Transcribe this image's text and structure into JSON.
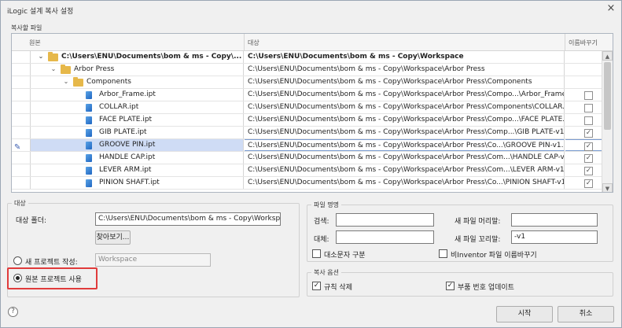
{
  "window": {
    "title": "iLogic 설계 복사 설정",
    "close_glyph": "×"
  },
  "files_section": {
    "label": "복사할 파일",
    "columns": {
      "source": "원본",
      "destination": "대상",
      "rename": "이름바꾸기"
    },
    "rows": [
      {
        "type": "folder",
        "expand": "⌄",
        "level": 0,
        "source": "C:\\Users\\ENU\\Documents\\bom & ms - Copy\\...",
        "destination": "C:\\Users\\ENU\\Documents\\bom & ms - Copy\\Workspace",
        "bold": true,
        "checkbox": null
      },
      {
        "type": "folder",
        "expand": "⌄",
        "level": 1,
        "source": "Arbor Press",
        "destination": "C:\\Users\\ENU\\Documents\\bom & ms - Copy\\Workspace\\Arbor Press",
        "bold": false,
        "checkbox": null
      },
      {
        "type": "folder",
        "expand": "⌄",
        "level": 2,
        "source": "Components",
        "destination": "C:\\Users\\ENU\\Documents\\bom & ms - Copy\\Workspace\\Arbor Press\\Components",
        "bold": false,
        "checkbox": null
      },
      {
        "type": "part",
        "level": 3,
        "source": "Arbor_Frame.ipt",
        "destination": "C:\\Users\\ENU\\Documents\\bom & ms - Copy\\Workspace\\Arbor Press\\Compo...\\Arbor_Frame.ipt",
        "bold": false,
        "checkbox": ""
      },
      {
        "type": "part",
        "level": 3,
        "source": "COLLAR.ipt",
        "destination": "C:\\Users\\ENU\\Documents\\bom & ms - Copy\\Workspace\\Arbor Press\\Components\\COLLAR.ipt",
        "bold": false,
        "checkbox": ""
      },
      {
        "type": "part",
        "level": 3,
        "source": "FACE PLATE.ipt",
        "destination": "C:\\Users\\ENU\\Documents\\bom & ms - Copy\\Workspace\\Arbor Press\\Compo...\\FACE PLATE.ipt",
        "bold": false,
        "checkbox": ""
      },
      {
        "type": "part",
        "level": 3,
        "source": "GIB PLATE.ipt",
        "destination": "C:\\Users\\ENU\\Documents\\bom & ms - Copy\\Workspace\\Arbor Press\\Comp...\\GIB PLATE-v1.ipt",
        "bold": false,
        "checkbox": "✓"
      },
      {
        "type": "part",
        "level": 3,
        "source": "GROOVE PIN.ipt",
        "destination": "C:\\Users\\ENU\\Documents\\bom & ms - Copy\\Workspace\\Arbor Press\\Co...\\GROOVE PIN-v1.ipt",
        "bold": false,
        "checkbox": "✓",
        "selected": true
      },
      {
        "type": "part",
        "level": 3,
        "source": "HANDLE CAP.ipt",
        "destination": "C:\\Users\\ENU\\Documents\\bom & ms - Copy\\Workspace\\Arbor Press\\Com...\\HANDLE CAP-v1.ipt",
        "bold": false,
        "checkbox": "✓"
      },
      {
        "type": "part",
        "level": 3,
        "source": "LEVER ARM.ipt",
        "destination": "C:\\Users\\ENU\\Documents\\bom & ms - Copy\\Workspace\\Arbor Press\\Com...\\LEVER ARM-v1.ipt",
        "bold": false,
        "checkbox": "✓"
      },
      {
        "type": "part",
        "level": 3,
        "source": "PINION SHAFT.ipt",
        "destination": "C:\\Users\\ENU\\Documents\\bom & ms - Copy\\Workspace\\Arbor Press\\Co...\\PINION SHAFT-v1.ipt",
        "bold": false,
        "checkbox": "✓"
      }
    ]
  },
  "target": {
    "legend": "대상",
    "folder_label": "대상 폴더:",
    "folder_value": "C:\\Users\\ENU\\Documents\\bom & ms - Copy\\Workspace",
    "browse_label": "찾아보기...",
    "new_project_label": "새 프로젝트 작성:",
    "new_project_value": "Workspace",
    "use_source_project_label": "원본 프로젝트 사용"
  },
  "file_naming": {
    "legend": "파일 명명",
    "search_label": "검색:",
    "search_value": "",
    "replace_label": "대체:",
    "replace_value": "",
    "prefix_label": "새 파일 머리말:",
    "prefix_value": "",
    "suffix_label": "새 파일 꼬리말:",
    "suffix_value": "-v1",
    "case_label": "대소문자 구분",
    "non_inventor_label": "비Inventor 파일 이름바꾸기"
  },
  "copy_options": {
    "legend": "복사 옵션",
    "delete_rules_label": "규칙 삭제",
    "update_part_numbers_label": "부품 번호 업데이트"
  },
  "footer": {
    "start_label": "시작",
    "cancel_label": "취소",
    "help_glyph": "?"
  },
  "icons": {
    "edit": "✎",
    "scroll_up": "▲",
    "scroll_down": "▼",
    "check": "✓"
  }
}
